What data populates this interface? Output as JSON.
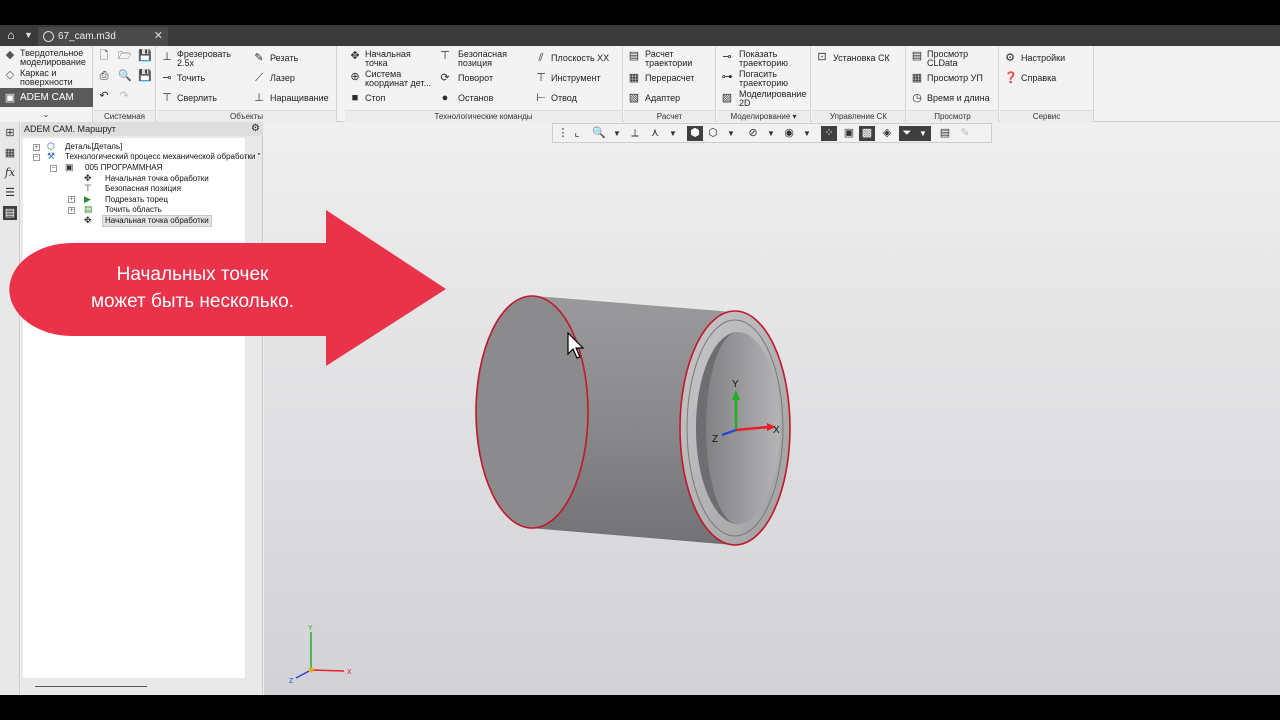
{
  "document_tab": "67_cam.m3d",
  "modes": {
    "solid": "Твердотельное\nмоделирование",
    "wire": "Каркас и\nповерхности",
    "active": "ADEM CAM"
  },
  "ribbon": {
    "system_label": "Системная",
    "objects": {
      "label": "Объекты",
      "mill": "Фрезеровать\n2.5x",
      "turn": "Точить",
      "drill": "Сверлить",
      "cut": "Резать",
      "laser": "Лазер",
      "build": "Наращивание"
    },
    "tech": {
      "label": "Технологические команды",
      "start_point": "Начальная\nточка",
      "coord_system": "Система\nкоординат дет...",
      "stop": "Стоп",
      "safe_pos": "Безопасная\nпозиция",
      "rotate": "Поворот",
      "halt": "Останов",
      "plane": "Плоскость XX",
      "tool": "Инструмент",
      "retract": "Отвод"
    },
    "calc": {
      "label": "Расчет",
      "calc_path": "Расчет\nтраектории",
      "recalc": "Перерасчет",
      "adapter": "Адаптер"
    },
    "modeling": {
      "label": "Моделирование",
      "show_path": "Показать\nтраекторию",
      "hide_path": "Погасить\nтраекторию",
      "model_2d": "Моделирование\n2D"
    },
    "cs": {
      "label": "Управление СК",
      "set_cs": "Установка СК"
    },
    "view": {
      "label": "Просмотр",
      "cldata": "Просмотр\nCLData",
      "up": "Просмотр УП",
      "time": "Время и длина"
    },
    "service": {
      "label": "Сервис",
      "settings": "Настройки",
      "help": "Справка"
    }
  },
  "tree": {
    "title": "ADEM CAM. Маршрут",
    "nodes": [
      "Деталь[Деталь]",
      "Технологический процесс механической обработки \"",
      "005 ПРОГРАММНАЯ",
      "Начальная точка обработки",
      "Безопасная позиция",
      "Подрезать торец",
      "Точить область",
      "Начальная точка обработки"
    ]
  },
  "callout": {
    "line1": "Начальных точек",
    "line2": "может быть несколько."
  },
  "axes": {
    "x": "X",
    "y": "Y",
    "z": "Z"
  },
  "colors": {
    "callout": "#e8334a",
    "edge": "#c2182b",
    "x_axis": "#e8202a",
    "y_axis": "#1fae2a",
    "z_axis": "#2a46d8"
  }
}
